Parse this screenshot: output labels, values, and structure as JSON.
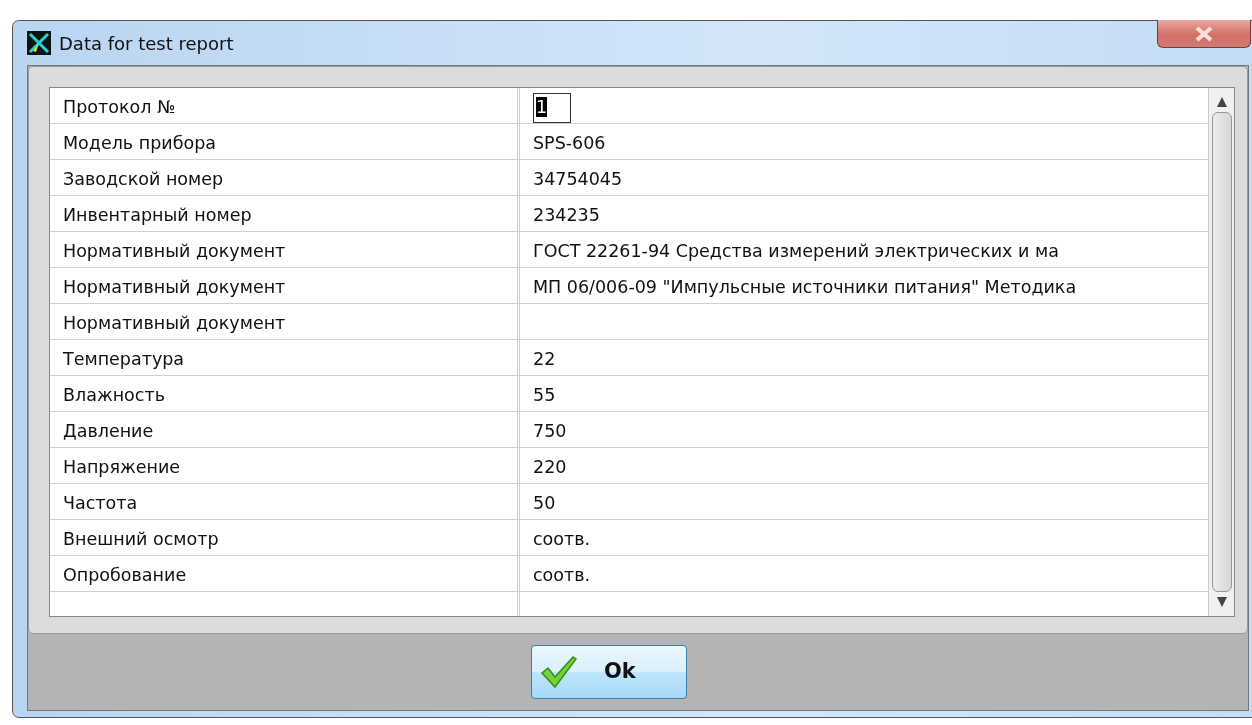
{
  "window": {
    "title": "Data for test report"
  },
  "rows": [
    {
      "label": "Протокол №",
      "value": "1",
      "editing": true
    },
    {
      "label": "Модель прибора",
      "value": "SPS-606",
      "editing": false
    },
    {
      "label": "Заводской номер",
      "value": "34754045",
      "editing": false
    },
    {
      "label": "Инвентарный номер",
      "value": "234235",
      "editing": false
    },
    {
      "label": "Нормативный документ",
      "value": "ГОСТ 22261-94 Средства измерений электрических и ма",
      "editing": false
    },
    {
      "label": "Нормативный документ",
      "value": "МП 06/006-09 \"Импульсные источники питания\" Методика",
      "editing": false
    },
    {
      "label": "Нормативный документ",
      "editing": false
    },
    {
      "label": "Температура",
      "value": "22",
      "editing": false
    },
    {
      "label": "Влажность",
      "value": "55",
      "editing": false
    },
    {
      "label": "Давление",
      "value": "750",
      "editing": false
    },
    {
      "label": "Напряжение",
      "value": "220",
      "editing": false
    },
    {
      "label": "Частота",
      "value": "50",
      "editing": false
    },
    {
      "label": "Внешний осмотр",
      "value": "соотв.",
      "editing": false
    },
    {
      "label": "Опробование",
      "value": "соотв.",
      "editing": false
    }
  ],
  "buttons": [
    {
      "label": "Ok"
    }
  ]
}
